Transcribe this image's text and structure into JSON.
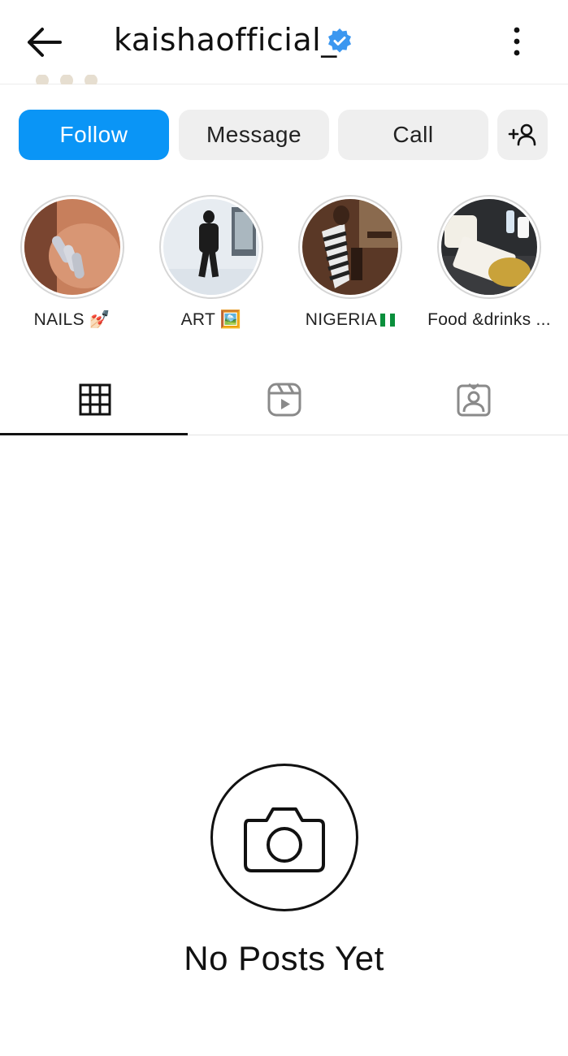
{
  "header": {
    "username": "kaishaofficial_",
    "verified": true,
    "back_icon": "arrow-left-icon",
    "more_icon": "more-vertical-icon"
  },
  "actions": {
    "follow_label": "Follow",
    "message_label": "Message",
    "call_label": "Call",
    "add_icon": "add-person-icon"
  },
  "highlights": [
    {
      "label": "NAILS 💅🏻"
    },
    {
      "label": "ART 🖼️"
    },
    {
      "label": "NIGERIA"
    },
    {
      "label": "Food &drinks ..."
    }
  ],
  "tabs": [
    {
      "icon": "grid-icon",
      "active": true
    },
    {
      "icon": "reels-icon",
      "active": false
    },
    {
      "icon": "tagged-icon",
      "active": false
    }
  ],
  "empty_state": {
    "icon": "camera-icon",
    "title": "No Posts Yet"
  },
  "colors": {
    "accent": "#0a95f6",
    "button_bg": "#efefef",
    "verified": "#3b97f0"
  }
}
